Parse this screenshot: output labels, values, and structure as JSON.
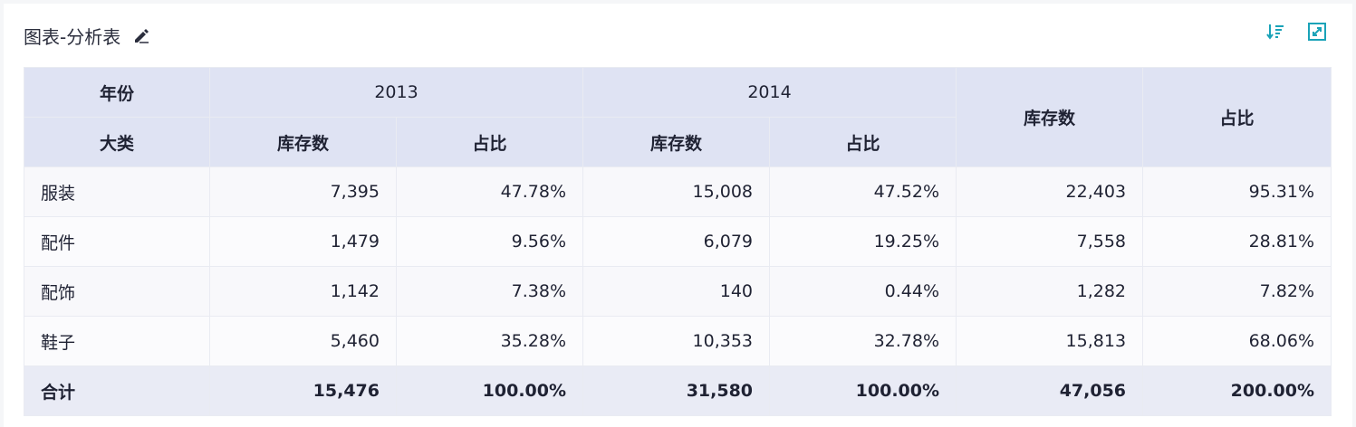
{
  "widget": {
    "title": "图表-分析表",
    "icons": {
      "edit": "edit-pen-icon",
      "sort": "sort-descending-icon",
      "expand": "expand-fullscreen-icon"
    },
    "accent_color": "#1aa3b8"
  },
  "table": {
    "header": {
      "row_dim_label": "年份",
      "col_dim_label": "大类",
      "years": [
        "2013",
        "2014"
      ],
      "metric_stock": "库存数",
      "metric_ratio": "占比",
      "total_stock": "库存数",
      "total_ratio": "占比"
    },
    "rows": [
      {
        "name": "服装",
        "v": [
          "7,395",
          "47.78%",
          "15,008",
          "47.52%",
          "22,403",
          "95.31%"
        ]
      },
      {
        "name": "配件",
        "v": [
          "1,479",
          "9.56%",
          "6,079",
          "19.25%",
          "7,558",
          "28.81%"
        ]
      },
      {
        "name": "配饰",
        "v": [
          "1,142",
          "7.38%",
          "140",
          "0.44%",
          "1,282",
          "7.82%"
        ]
      },
      {
        "name": "鞋子",
        "v": [
          "5,460",
          "35.28%",
          "10,353",
          "32.78%",
          "15,813",
          "68.06%"
        ]
      }
    ],
    "total": {
      "name": "合计",
      "v": [
        "15,476",
        "100.00%",
        "31,580",
        "100.00%",
        "47,056",
        "200.00%"
      ]
    }
  }
}
